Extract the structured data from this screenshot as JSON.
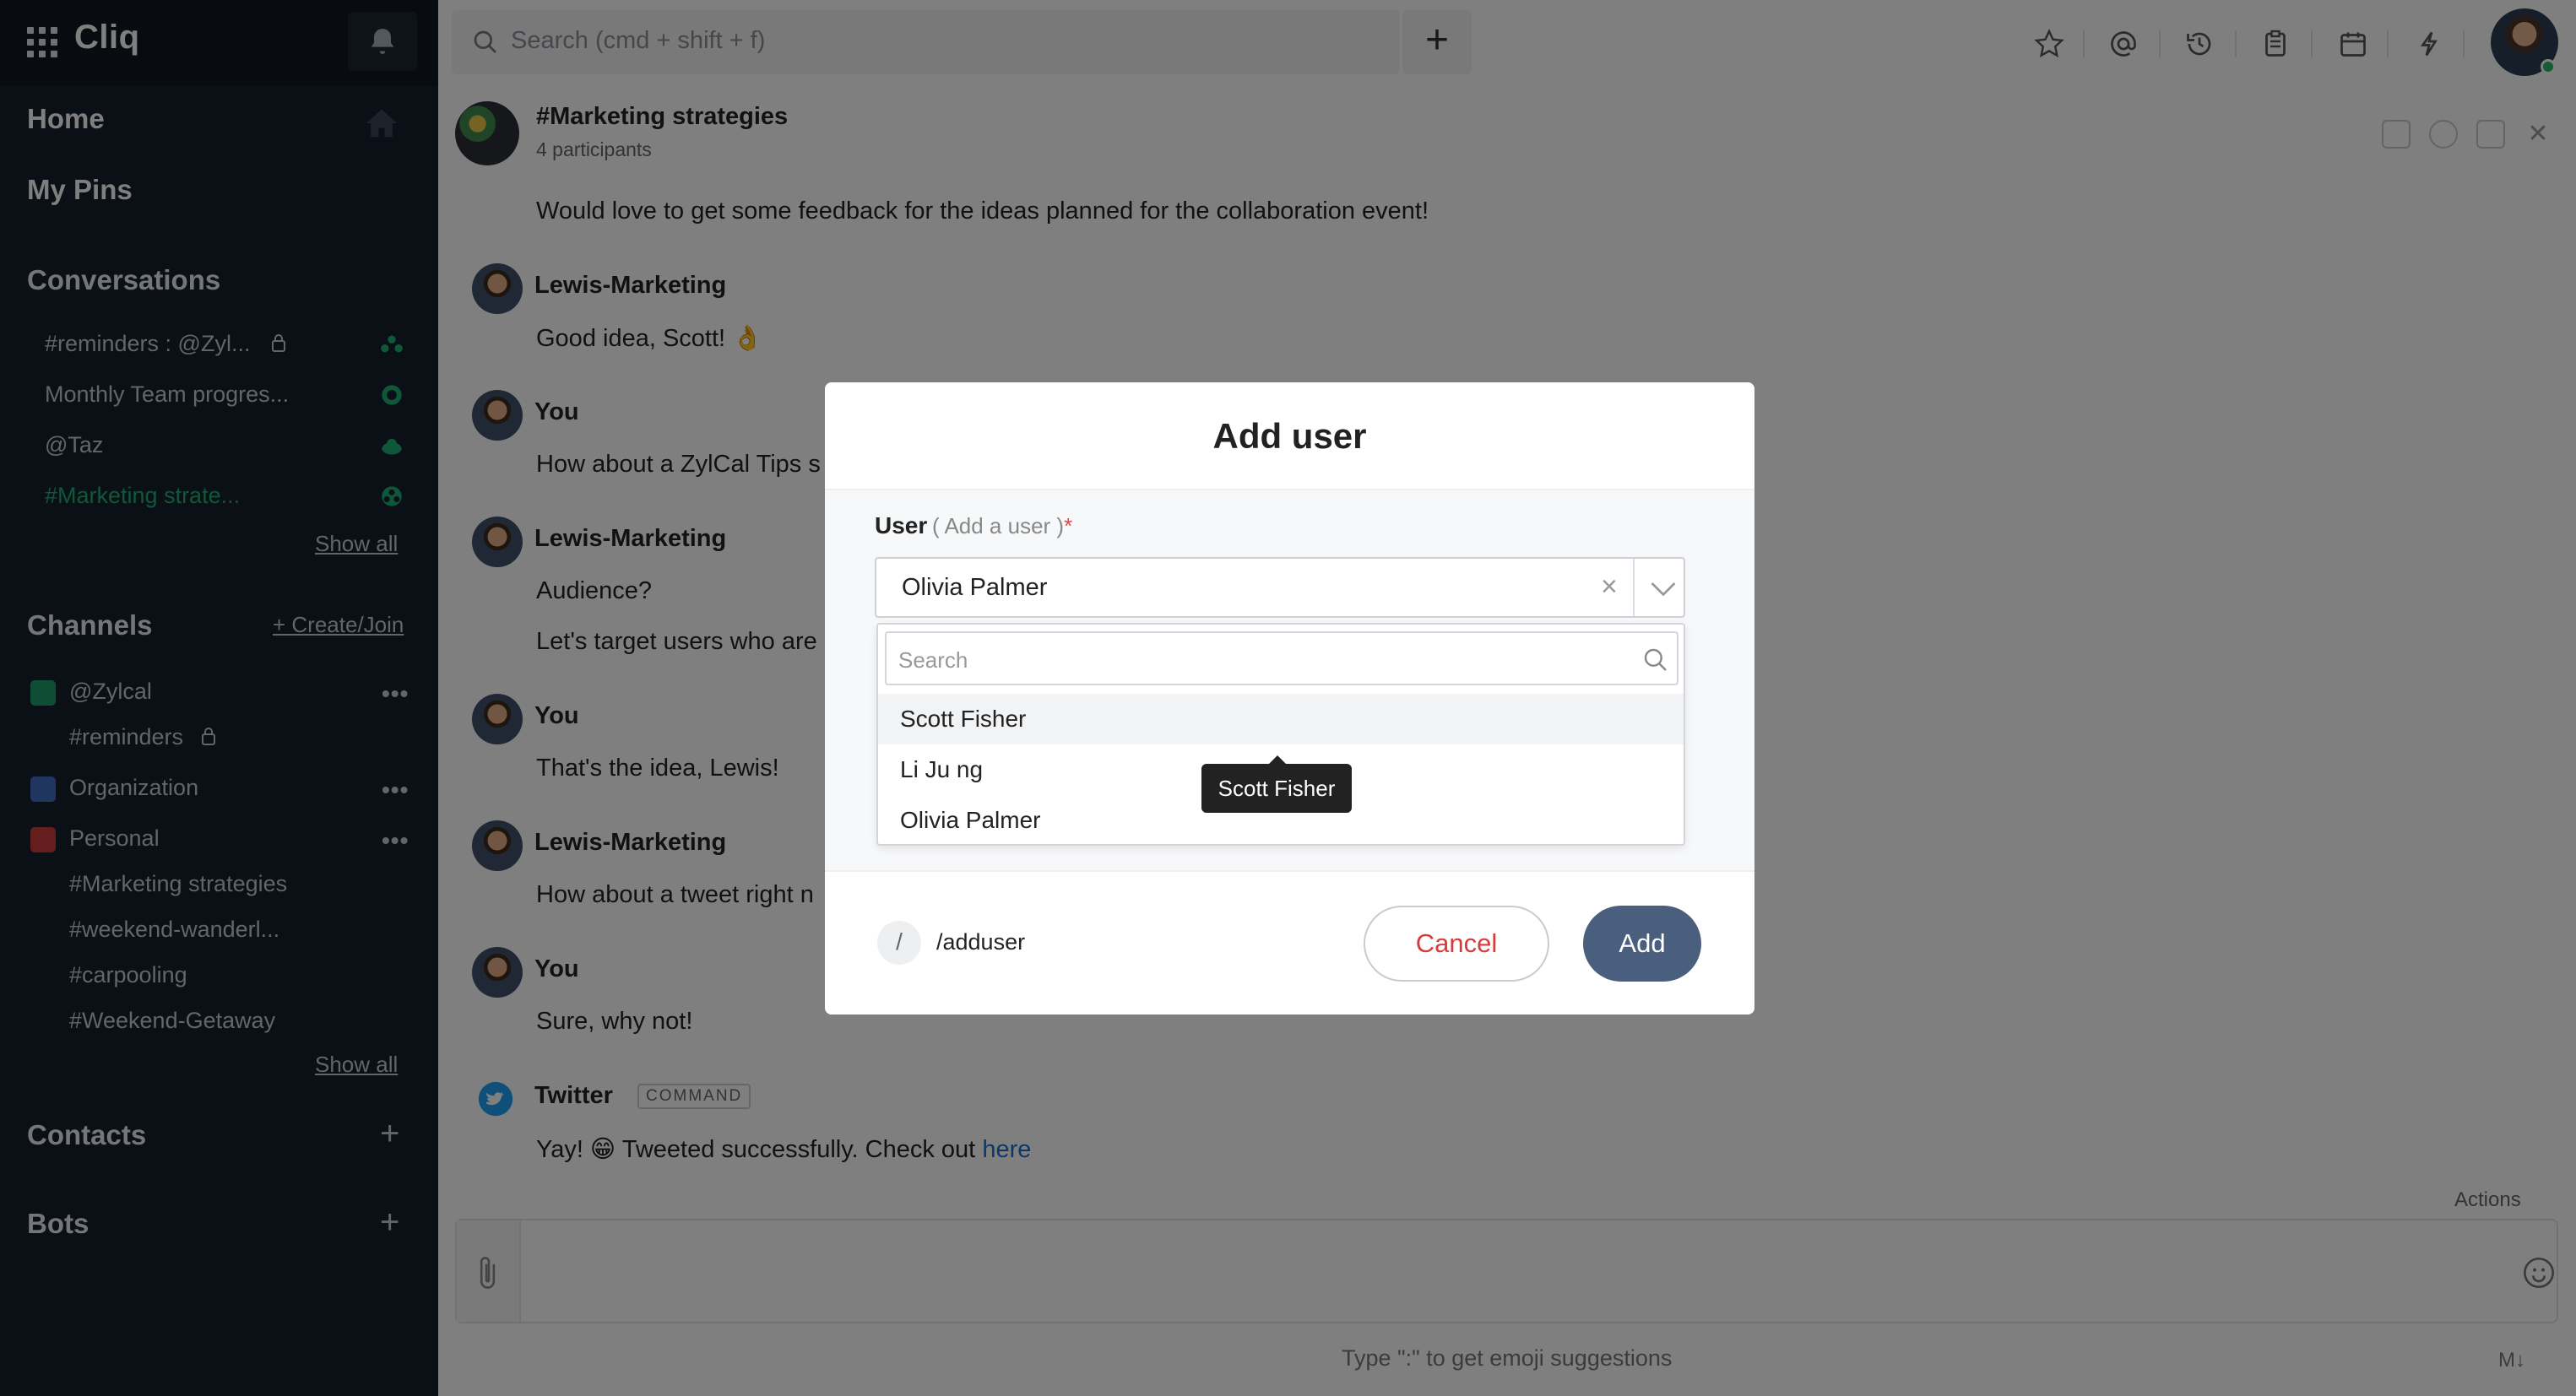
{
  "app": {
    "name": "Cliq"
  },
  "sidebar": {
    "home": "Home",
    "pins": "My Pins",
    "conversations_title": "Conversations",
    "conversations": [
      {
        "label": "#reminders : @Zyl...",
        "locked": true,
        "active": false
      },
      {
        "label": "Monthly Team progres...",
        "active": false
      },
      {
        "label": "@Taz",
        "active": false
      },
      {
        "label": "#Marketing strate...",
        "active": true
      }
    ],
    "conversations_show_all": "Show all",
    "channels_title": "Channels",
    "channels_create": "+ Create/Join",
    "channels": [
      {
        "label": "@Zylcal",
        "badge_color": "#1e9c6a"
      },
      {
        "label": "#reminders",
        "locked": true
      },
      {
        "label": "Organization",
        "badge_color": "#3e6fc0"
      },
      {
        "label": "Personal",
        "badge_color": "#c93c3c"
      },
      {
        "label": "#Marketing strategies"
      },
      {
        "label": "#weekend-wanderl..."
      },
      {
        "label": "#carpooling"
      },
      {
        "label": "#Weekend-Getaway"
      }
    ],
    "channels_show_all": "Show all",
    "contacts_title": "Contacts",
    "bots_title": "Bots"
  },
  "topbar": {
    "search_placeholder": "Search (cmd + shift + f)",
    "icons": [
      "star-icon",
      "mention-icon",
      "history-icon",
      "notes-icon",
      "calendar-icon",
      "integrations-icon"
    ]
  },
  "chat": {
    "title": "#Marketing strategies",
    "participants": "4 participants",
    "messages": [
      {
        "text": "Would love to get some feedback for the ideas planned for the collaboration event!"
      },
      {
        "sender": "Lewis-Marketing",
        "lines": [
          "Good idea, Scott! 👌"
        ]
      },
      {
        "sender": "You",
        "lines": [
          "How about a ZylCal Tips s"
        ]
      },
      {
        "sender": "Lewis-Marketing",
        "lines": [
          "Audience?",
          "Let's target users who are"
        ]
      },
      {
        "sender": "You",
        "lines": [
          "That's the idea, Lewis!"
        ]
      },
      {
        "sender": "Lewis-Marketing",
        "lines": [
          "How about a tweet right n"
        ]
      },
      {
        "sender": "You",
        "lines": [
          "Sure, why not!"
        ]
      },
      {
        "sender": "Twitter",
        "badge": "COMMAND",
        "text_before": "Yay! 😁 Tweeted successfully. Check out ",
        "link": "here"
      }
    ],
    "actions_label": "Actions",
    "composer_hint": "Type \":\" to get emoji suggestions",
    "markdown_label": "M↓"
  },
  "modal": {
    "title": "Add user",
    "field_label": "User",
    "field_hint": "( Add a user )",
    "required_mark": "*",
    "selected_value": "Olivia Palmer",
    "dropdown_search_placeholder": "Search",
    "options": [
      "Scott Fisher",
      "Li Ju ng",
      "Olivia Palmer"
    ],
    "tooltip": "Scott Fisher",
    "slash_symbol": "/",
    "slash_command": "/adduser",
    "cancel_label": "Cancel",
    "add_label": "Add"
  }
}
